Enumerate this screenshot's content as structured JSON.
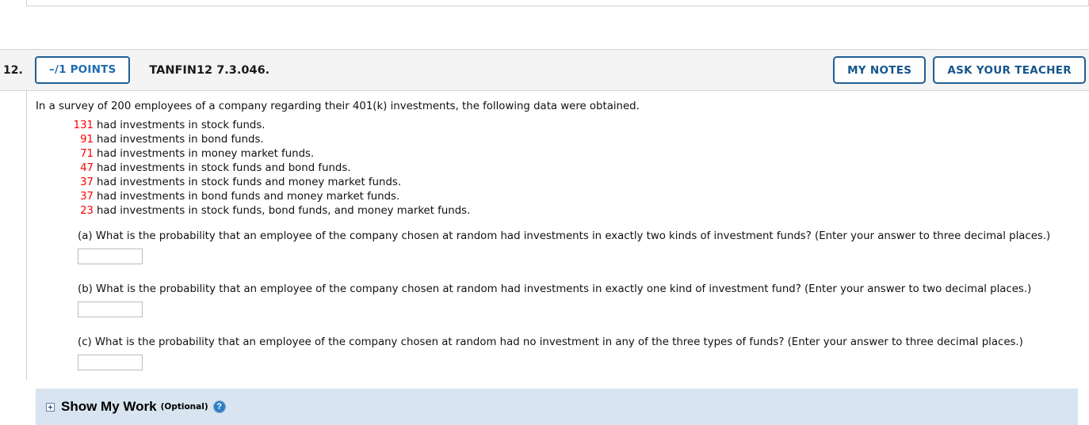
{
  "header": {
    "number": "12.",
    "points_label": "–/1 POINTS",
    "question_code": "TANFIN12 7.3.046.",
    "my_notes_label": "MY NOTES",
    "ask_teacher_label": "ASK YOUR TEACHER"
  },
  "question": {
    "intro": "In a survey of 200 employees of a company regarding their 401(k) investments, the following data were obtained.",
    "data": [
      {
        "count": "131",
        "text": "had investments in stock funds."
      },
      {
        "count": "91",
        "text": "had investments in bond funds."
      },
      {
        "count": "71",
        "text": "had investments in money market funds."
      },
      {
        "count": "47",
        "text": "had investments in stock funds and bond funds."
      },
      {
        "count": "37",
        "text": "had investments in stock funds and money market funds."
      },
      {
        "count": "37",
        "text": "had investments in bond funds and money market funds."
      },
      {
        "count": "23",
        "text": "had investments in stock funds, bond funds, and money market funds."
      }
    ],
    "parts": [
      {
        "label": "(a) What is the probability that an employee of the company chosen at random had investments in exactly two kinds of investment funds? (Enter your answer to three decimal places.)",
        "value": "",
        "placeholder": ""
      },
      {
        "label": "(b) What is the probability that an employee of the company chosen at random had investments in exactly one kind of investment fund? (Enter your answer to two decimal places.)",
        "value": "",
        "placeholder": ""
      },
      {
        "label": "(c) What is the probability that an employee of the company chosen at random had no investment in any of the three types of funds? (Enter your answer to three decimal places.)",
        "value": "",
        "placeholder": ""
      }
    ]
  },
  "show_my_work": {
    "title": "Show My Work",
    "optional": "(Optional)",
    "help_glyph": "?",
    "expand_icon": "plus-box-icon"
  },
  "colors": {
    "accent_blue": "#1f5f96",
    "data_red": "#ff0000",
    "header_bg": "#f4f4f4",
    "panel_blue": "#d8e5f0"
  }
}
